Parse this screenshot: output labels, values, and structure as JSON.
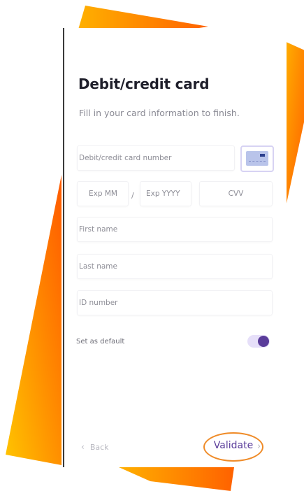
{
  "form": {
    "title": "Debit/credit card",
    "subtitle": "Fill in your card information to finish.",
    "card_number_placeholder": "Debit/credit card number",
    "exp_mm_placeholder": "Exp MM",
    "separator": "/",
    "exp_yyyy_placeholder": "Exp YYYY",
    "cvv_placeholder": "CVV",
    "first_name_placeholder": "First name",
    "last_name_placeholder": "Last name",
    "id_number_placeholder": "ID number",
    "set_default_label": "Set as default",
    "set_default_on": true
  },
  "footer": {
    "back_label": "Back",
    "back_icon": "chevron-left-icon",
    "validate_label": "Validate",
    "next_icon": "chevron-right-icon"
  },
  "colors": {
    "accent": "#5a3c9a",
    "highlight": "#ef8b28",
    "decor_orange": "#ff6a00",
    "decor_yellow": "#ffc400"
  }
}
